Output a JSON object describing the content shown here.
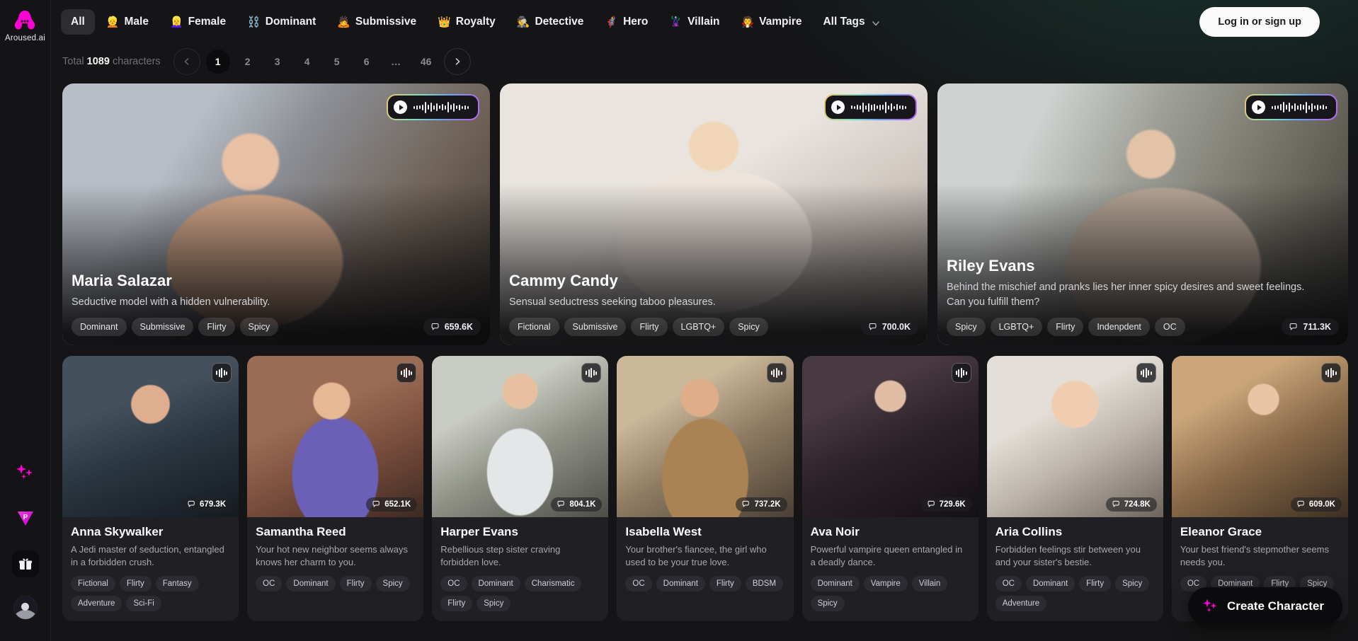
{
  "brand": {
    "name": "Aroused.ai",
    "logo_icon": "aroused-logo-icon"
  },
  "sidebar": {
    "avatars": [
      {
        "name": "recent-character-1"
      },
      {
        "name": "recent-character-2"
      },
      {
        "name": "recent-character-3"
      }
    ],
    "icons": [
      {
        "name": "sparkles-icon",
        "label": "Sparkles"
      },
      {
        "name": "premium-diamond-icon",
        "label": "P"
      },
      {
        "name": "gift-icon",
        "label": "Gift"
      },
      {
        "name": "profile-avatar-icon",
        "label": "Profile"
      }
    ]
  },
  "topnav": {
    "tabs": [
      {
        "label": "All",
        "emoji": "",
        "active": true
      },
      {
        "label": "Male",
        "emoji": "👱",
        "active": false
      },
      {
        "label": "Female",
        "emoji": "👱‍♀️",
        "active": false
      },
      {
        "label": "Dominant",
        "emoji": "⛓️",
        "active": false
      },
      {
        "label": "Submissive",
        "emoji": "🙇",
        "active": false
      },
      {
        "label": "Royalty",
        "emoji": "👑",
        "active": false
      },
      {
        "label": "Detective",
        "emoji": "🕵️",
        "active": false
      },
      {
        "label": "Hero",
        "emoji": "🦸",
        "active": false
      },
      {
        "label": "Villain",
        "emoji": "🦹",
        "active": false
      },
      {
        "label": "Vampire",
        "emoji": "🧛",
        "active": false
      },
      {
        "label": "All Tags",
        "emoji": "",
        "active": false,
        "has_chevron": true
      }
    ],
    "login_label": "Log in or sign up"
  },
  "meta": {
    "total_prefix": "Total",
    "total_count": "1089",
    "total_suffix": "characters"
  },
  "pagination": {
    "prev_icon": "chevron-left-icon",
    "next_icon": "chevron-right-icon",
    "pages": [
      "1",
      "2",
      "3",
      "4",
      "5",
      "6",
      "…",
      "46"
    ],
    "current": "1"
  },
  "featured": [
    {
      "name": "Maria Salazar",
      "description": "Seductive model with a hidden vulnerability.",
      "tags": [
        "Dominant",
        "Submissive",
        "Flirty",
        "Spicy"
      ],
      "views": "659.6K",
      "audio": true,
      "photo_class": "p-maria"
    },
    {
      "name": "Cammy Candy",
      "description": "Sensual seductress seeking taboo pleasures.",
      "tags": [
        "Fictional",
        "Submissive",
        "Flirty",
        "LGBTQ+",
        "Spicy"
      ],
      "views": "700.0K",
      "audio": true,
      "photo_class": "p-cammy"
    },
    {
      "name": "Riley Evans",
      "description": "Behind the mischief and pranks lies her inner spicy desires and sweet feelings. Can you fulfill them?",
      "tags": [
        "Spicy",
        "LGBTQ+",
        "Flirty",
        "Indenpdent",
        "OC"
      ],
      "views": "711.3K",
      "audio": true,
      "photo_class": "p-riley"
    }
  ],
  "grid": [
    {
      "name": "Anna Skywalker",
      "description": "A Jedi master of seduction, entangled in a forbidden crush.",
      "tags": [
        "Fictional",
        "Flirty",
        "Fantasy",
        "Adventure",
        "Sci-Fi"
      ],
      "views": "679.3K",
      "photo_class": "p-anna"
    },
    {
      "name": "Samantha Reed",
      "description": "Your hot new neighbor seems always knows her charm to you.",
      "tags": [
        "OC",
        "Dominant",
        "Flirty",
        "Spicy"
      ],
      "views": "652.1K",
      "photo_class": "p-sam"
    },
    {
      "name": "Harper Evans",
      "description": "Rebellious step sister craving forbidden love.",
      "tags": [
        "OC",
        "Dominant",
        "Charismatic",
        "Flirty",
        "Spicy"
      ],
      "views": "804.1K",
      "photo_class": "p-harper"
    },
    {
      "name": "Isabella West",
      "description": "Your brother's fiancee, the girl who used to be your true love.",
      "tags": [
        "OC",
        "Dominant",
        "Flirty",
        "BDSM"
      ],
      "views": "737.2K",
      "photo_class": "p-isabella"
    },
    {
      "name": "Ava Noir",
      "description": "Powerful vampire queen entangled in a deadly dance.",
      "tags": [
        "Dominant",
        "Vampire",
        "Villain",
        "Spicy"
      ],
      "views": "729.6K",
      "photo_class": "p-ava"
    },
    {
      "name": "Aria Collins",
      "description": "Forbidden feelings stir between you and your sister's bestie.",
      "tags": [
        "OC",
        "Dominant",
        "Flirty",
        "Spicy",
        "Adventure"
      ],
      "views": "724.8K",
      "photo_class": "p-aria"
    },
    {
      "name": "Eleanor Grace",
      "description": "Your best friend's stepmother seems needs you.",
      "tags": [
        "OC",
        "Dominant",
        "Flirty",
        "Spicy"
      ],
      "views": "609.0K",
      "photo_class": "p-eleanor"
    }
  ],
  "fab": {
    "label": "Create Character",
    "icon": "sparkles-icon"
  },
  "colors": {
    "brand_pink": "#ff00d4",
    "page_bg": "#121214",
    "card_bg": "#202024",
    "accent_green_glow": "#1a4034"
  }
}
